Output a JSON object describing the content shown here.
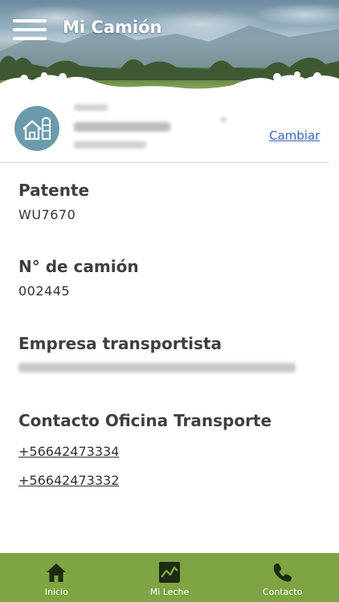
{
  "header": {
    "title": "Mi Camión",
    "menu_icon": "hamburger-menu-icon"
  },
  "user": {
    "avatar_icon": "house-silo-icon",
    "change_label": "Cambiar"
  },
  "sections": {
    "patente": {
      "label": "Patente",
      "value": "WU7670"
    },
    "camion": {
      "label": "N° de camión",
      "value": "002445"
    },
    "empresa": {
      "label": "Empresa transportista"
    },
    "contacto": {
      "label": "Contacto Oficina Transporte",
      "phones": [
        "+56642473334",
        "+56642473332"
      ]
    }
  },
  "nav": {
    "accent": "#7ea443",
    "items": [
      {
        "label": "Inicio",
        "icon": "home-icon"
      },
      {
        "label": "Mi Leche",
        "icon": "chart-icon"
      },
      {
        "label": "Contacto",
        "icon": "phone-icon"
      }
    ]
  }
}
